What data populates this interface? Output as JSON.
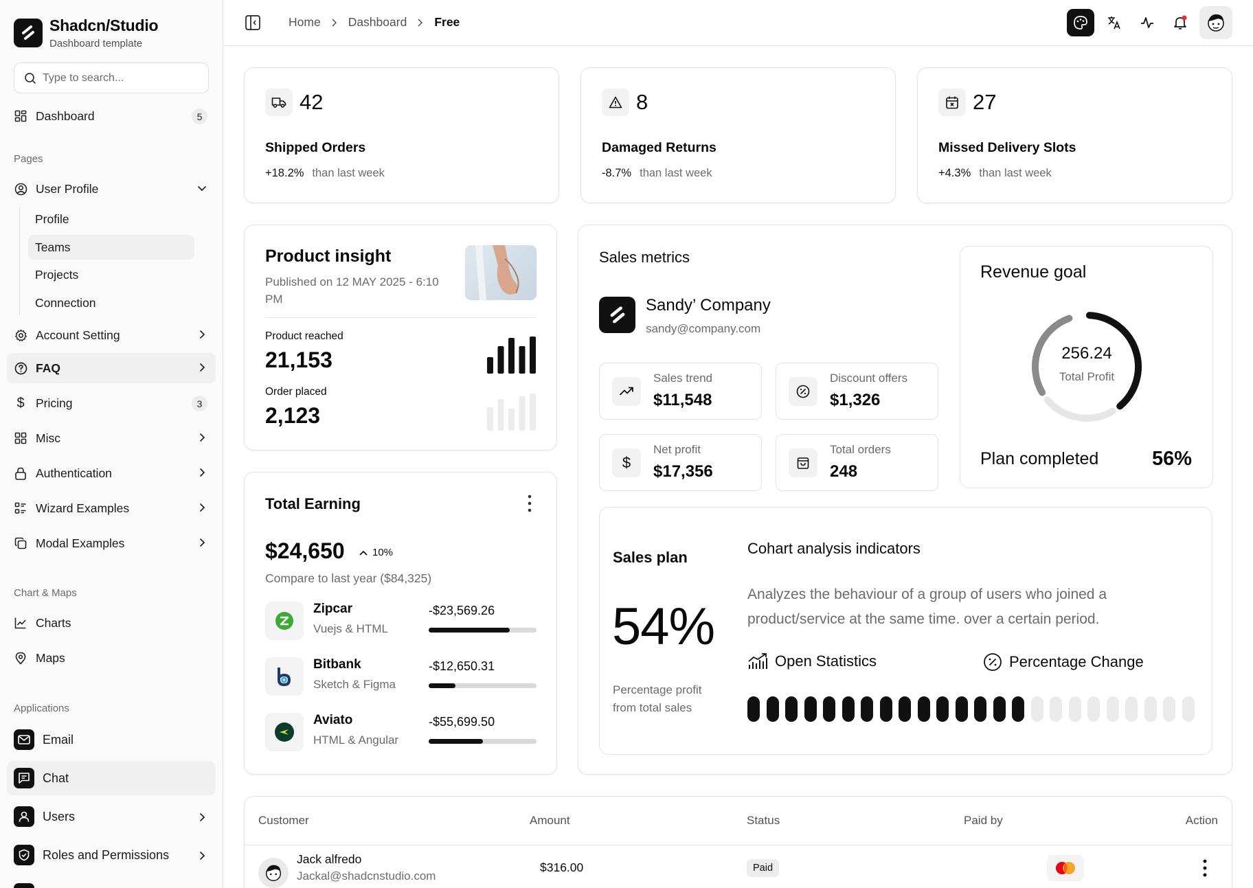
{
  "brand": {
    "title": "Shadcn/Studio",
    "subtitle": "Dashboard template"
  },
  "search": {
    "placeholder": "Type to search..."
  },
  "nav": {
    "dashboard": {
      "label": "Dashboard",
      "badge": "5"
    },
    "pages_label": "Pages",
    "user_profile": "User Profile",
    "sub": [
      "Profile",
      "Teams",
      "Projects",
      "Connection"
    ],
    "account_setting": "Account Setting",
    "faq": "FAQ",
    "pricing": {
      "label": "Pricing",
      "badge": "3"
    },
    "misc": "Misc",
    "authentication": "Authentication",
    "wizard": "Wizard Examples",
    "modal": "Modal Examples",
    "charts_label": "Chart & Maps",
    "charts": "Charts",
    "maps": "Maps",
    "apps_label": "Applications",
    "email": "Email",
    "chat": "Chat",
    "users": "Users",
    "roles": "Roles and Permissions"
  },
  "breadcrumb": [
    "Home",
    "Dashboard",
    "Free"
  ],
  "stats": [
    {
      "value": "42",
      "title": "Shipped Orders",
      "change": "+18.2%",
      "label": "than last week",
      "icon": "truck-icon"
    },
    {
      "value": "8",
      "title": "Damaged Returns",
      "change": "-8.7%",
      "label": "than last week",
      "icon": "alert-triangle-icon"
    },
    {
      "value": "27",
      "title": "Missed Delivery Slots",
      "change": "+4.3%",
      "label": "than last week",
      "icon": "calendar-x-icon"
    }
  ],
  "insight": {
    "title": "Product insight",
    "published": "Published on 12 MAY 2025 - 6:10 PM",
    "reached_label": "Product reached",
    "reached_value": "21,153",
    "order_label": "Order placed",
    "order_value": "2,123"
  },
  "earning": {
    "title": "Total Earning",
    "amount": "$24,650",
    "change": "10%",
    "compare": "Compare to last year ($84,325)",
    "rows": [
      {
        "name": "Zipcar",
        "sub": "Vuejs & HTML",
        "amount": "-$23,569.26",
        "progress": 0.75
      },
      {
        "name": "Bitbank",
        "sub": "Sketch & Figma",
        "amount": "-$12,650.31",
        "progress": 0.25
      },
      {
        "name": "Aviato",
        "sub": "HTML & Angular",
        "amount": "-$55,699.50",
        "progress": 0.5
      }
    ]
  },
  "sales": {
    "title": "Sales metrics",
    "company": "Sandy’ Company",
    "email": "sandy@company.com",
    "metrics": [
      {
        "label": "Sales trend",
        "value": "$11,548"
      },
      {
        "label": "Discount offers",
        "value": "$1,326"
      },
      {
        "label": "Net profit",
        "value": "$17,356"
      },
      {
        "label": "Total orders",
        "value": "248"
      }
    ]
  },
  "revenue": {
    "title": "Revenue goal",
    "value": "256.24",
    "label": "Total Profit",
    "plan_label": "Plan completed",
    "plan_pct": "56%",
    "progress": 0.56
  },
  "plan": {
    "title": "Sales plan",
    "pct": "54%",
    "desc": "Percentage profit from total sales",
    "cohort_title": "Cohart analysis indicators",
    "cohort_desc": "Analyzes the behaviour of a group of users who joined a product/service at the same time. over a certain period.",
    "open_stats": "Open Statistics",
    "pct_change": "Percentage Change",
    "bars_total": 24,
    "bars_filled": 15
  },
  "table": {
    "headers": [
      "Customer",
      "Amount",
      "Status",
      "Paid by",
      "Action"
    ],
    "rows": [
      {
        "name": "Jack alfredo",
        "email": "Jackal@shadcnstudio.com",
        "amount": "$316.00",
        "status": "Paid"
      }
    ]
  },
  "colors": {
    "accent": "#111111",
    "track": "#e6e6e6",
    "muted": "#6b6b6b",
    "mastercard_red": "#eb001b",
    "mastercard_orange": "#f79e1b"
  }
}
